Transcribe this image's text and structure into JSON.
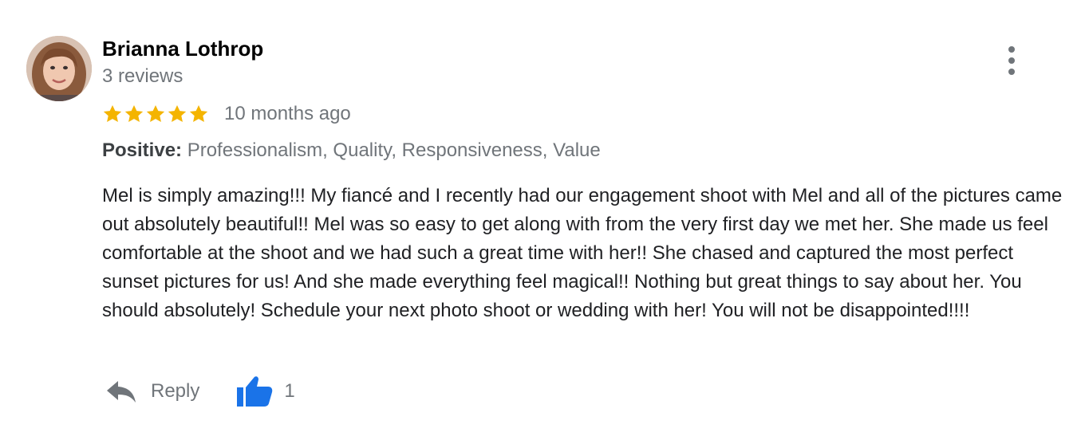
{
  "review": {
    "author": {
      "name": "Brianna Lothrop",
      "review_count": "3 reviews",
      "avatar_icon": "profile-photo"
    },
    "rating": {
      "stars": 5,
      "max_stars": 5,
      "star_color": "#f4b400"
    },
    "date": "10 months ago",
    "attributes": {
      "label": "Positive:",
      "values": "Professionalism, Quality, Responsiveness, Value"
    },
    "text": "Mel is simply amazing!!! My fiancé and I recently had our engagement shoot with Mel and all of the pictures came out absolutely beautiful!! Mel was so easy to get along with from the very first day we met her. She made us feel comfortable at the shoot and we had such a great time with her!! She chased and captured the most perfect sunset pictures for us! And she made everything feel magical!! Nothing but great things to say about her. You should absolutely! Schedule your next photo shoot or wedding with her! You will not be disappointed!!!!",
    "actions": {
      "reply_label": "Reply",
      "reply_icon": "reply-arrow-icon",
      "like_icon": "thumbs-up-icon",
      "like_count": "1",
      "more_icon": "vertical-dots-icon"
    },
    "colors": {
      "accent_blue": "#1a73e8",
      "secondary_text": "#70757a"
    }
  }
}
